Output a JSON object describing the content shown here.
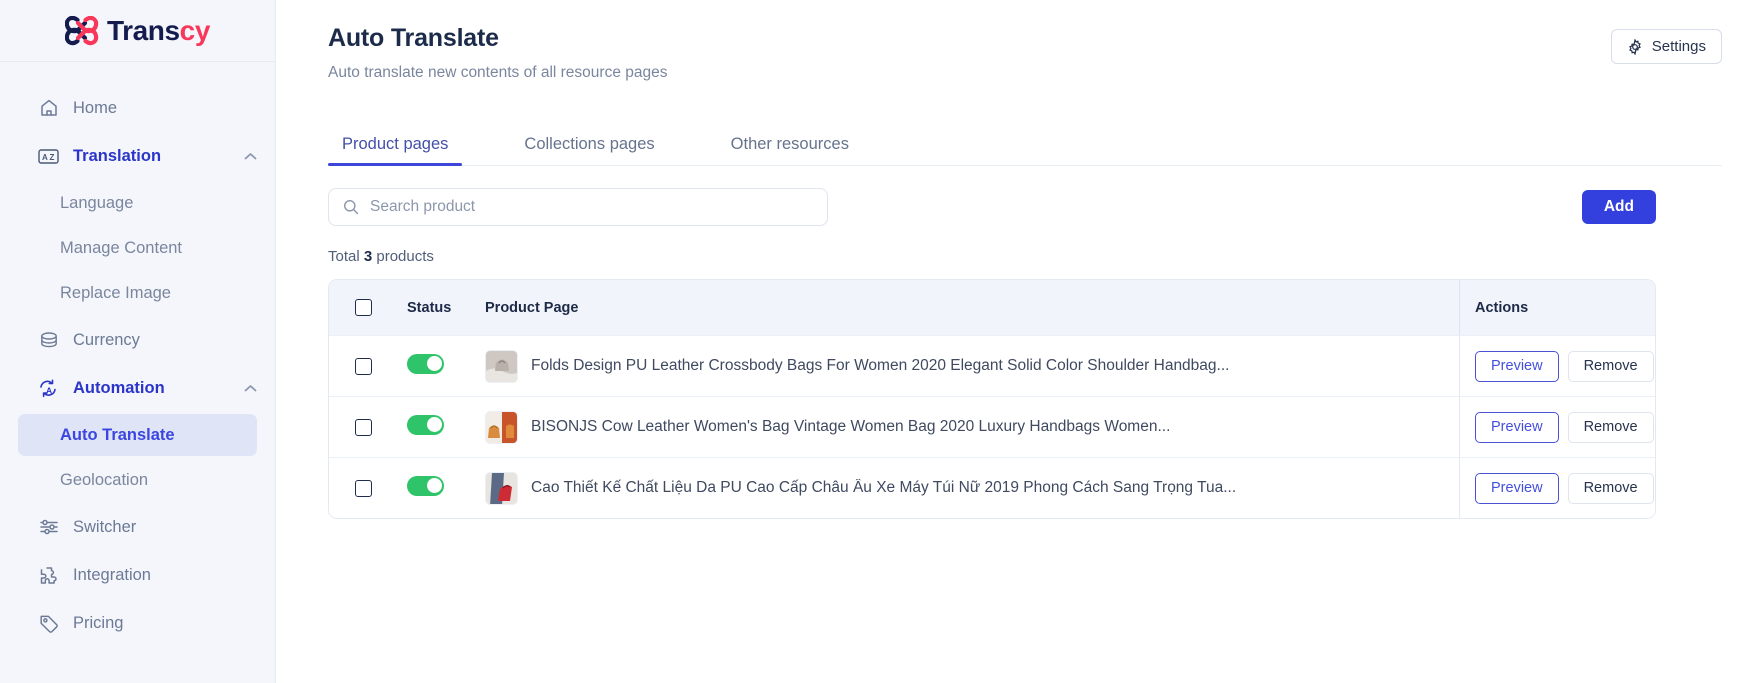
{
  "brand": {
    "name_dark": "Trans",
    "name_pink": "cy",
    "logo_icon": "transcy-knot-logo",
    "color_dark": "#141b4d",
    "color_pink": "#f7385b"
  },
  "sidebar": {
    "items": [
      {
        "label": "Home",
        "icon": "home-icon",
        "type": "item",
        "state": "default"
      },
      {
        "label": "Translation",
        "icon": "translate-az-icon",
        "type": "item",
        "state": "expanded",
        "chevron": "chevron-up-icon"
      },
      {
        "label": "Language",
        "icon": "",
        "type": "sub",
        "state": "default"
      },
      {
        "label": "Manage Content",
        "icon": "",
        "type": "sub",
        "state": "default"
      },
      {
        "label": "Replace Image",
        "icon": "",
        "type": "sub",
        "state": "default"
      },
      {
        "label": "Currency",
        "icon": "coins-icon",
        "type": "item",
        "state": "default"
      },
      {
        "label": "Automation",
        "icon": "automation-refresh-a-icon",
        "type": "item",
        "state": "expanded",
        "chevron": "chevron-up-icon"
      },
      {
        "label": "Auto Translate",
        "icon": "",
        "type": "sub",
        "state": "active"
      },
      {
        "label": "Geolocation",
        "icon": "",
        "type": "sub",
        "state": "default"
      },
      {
        "label": "Switcher",
        "icon": "sliders-icon",
        "type": "item",
        "state": "default"
      },
      {
        "label": "Integration",
        "icon": "puzzle-icon",
        "type": "item",
        "state": "default"
      },
      {
        "label": "Pricing",
        "icon": "tag-icon",
        "type": "item",
        "state": "default"
      }
    ]
  },
  "header": {
    "title": "Auto Translate",
    "subtitle": "Auto translate new contents of all resource pages",
    "settings_label": "Settings",
    "settings_icon": "gear-icon"
  },
  "tabs": [
    {
      "label": "Product pages",
      "active": true
    },
    {
      "label": "Collections pages",
      "active": false
    },
    {
      "label": "Other resources",
      "active": false
    }
  ],
  "toolbar": {
    "search_placeholder": "Search product",
    "search_value": "",
    "search_icon": "search-icon",
    "add_label": "Add"
  },
  "summary": {
    "prefix": "Total",
    "count": "3",
    "suffix": "products"
  },
  "table": {
    "columns": {
      "status": "Status",
      "product_page": "Product Page",
      "actions": "Actions"
    },
    "header_checkbox_checked": false,
    "rows": [
      {
        "checked": false,
        "status_on": true,
        "thumbnail": "handbag-white-thumbnail",
        "title": "Folds Design PU Leather Crossbody Bags For Women 2020 Elegant Solid Color Shoulder Handbag...",
        "preview_label": "Preview",
        "remove_label": "Remove"
      },
      {
        "checked": false,
        "status_on": true,
        "thumbnail": "handbag-orange-thumbnail",
        "title": "BISONJS Cow Leather Women's Bag Vintage Women Bag 2020 Luxury Handbags Women...",
        "preview_label": "Preview",
        "remove_label": "Remove"
      },
      {
        "checked": false,
        "status_on": true,
        "thumbnail": "handbag-red-thumbnail",
        "title": "Cao Thiết Kế Chất Liệu Da PU Cao Cấp Châu Âu Xe Máy Túi Nữ 2019 Phong Cách Sang Trọng Tua...",
        "preview_label": "Preview",
        "remove_label": "Remove"
      }
    ]
  },
  "colors": {
    "accent": "#3340dd",
    "toggle_on": "#2fc46a",
    "sidebar_bg": "#f4f6fb",
    "active_nav_bg": "#dfe4f7"
  }
}
